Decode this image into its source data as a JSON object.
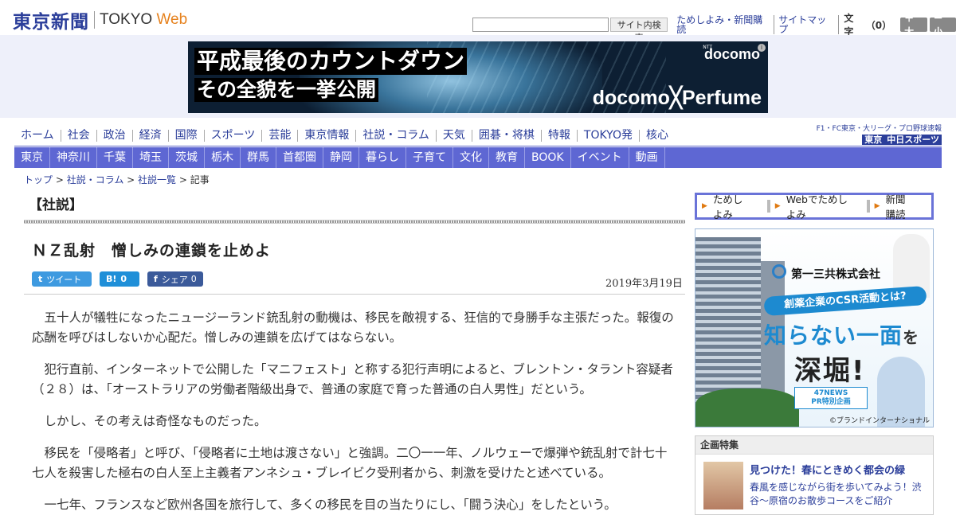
{
  "header": {
    "logo_jp": "東京新聞",
    "logo_en_prefix": "TOKYO ",
    "logo_en_suffix": "Web",
    "search_button": "サイト内検索",
    "links": [
      "ためしよみ・新聞購読",
      "サイトマップ"
    ],
    "text_size_label": "文字",
    "text_size_count": "（0）",
    "larger": "＋大",
    "smaller": "－小"
  },
  "banner": {
    "line1": "平成最後のカウントダウン",
    "line2": "その全貌を一挙公開",
    "brand": "docomo",
    "brand_small": "NTT",
    "collab": "docomo╳Perfume",
    "info": "i"
  },
  "nav_primary": [
    "ホーム",
    "社会",
    "政治",
    "経済",
    "国際",
    "スポーツ",
    "芸能",
    "東京情報",
    "社説・コラム",
    "天気",
    "囲碁・将棋",
    "特報",
    "TOKYO発",
    "核心"
  ],
  "sports_logo": {
    "top": "F1・FC東京・大リーグ・プロ野球速報",
    "prefix": "東京",
    "name": "中日スポーツ"
  },
  "nav_secondary": [
    "東京",
    "神奈川",
    "千葉",
    "埼玉",
    "茨城",
    "栃木",
    "群馬",
    "首都圏",
    "静岡",
    "暮らし",
    "子育て",
    "文化",
    "教育",
    "BOOK",
    "イベント",
    "動画"
  ],
  "breadcrumb": [
    "トップ",
    "社説・コラム",
    "社説一覧",
    "記事"
  ],
  "breadcrumb_sep": " > ",
  "article": {
    "section": "【社説】",
    "title": "ＮＺ乱射　憎しみの連鎖を止めよ",
    "date": "2019年3月19日",
    "share": {
      "tweet_icon": "t",
      "tweet": "ツイート",
      "hatena_icon": "B!",
      "hatena_count": "0",
      "fb_icon": "f",
      "fb": "シェア",
      "fb_count": "0"
    },
    "paragraphs": [
      "五十人が犠牲になったニュージーランド銃乱射の動機は、移民を敵視する、狂信的で身勝手な主張だった。報復の応酬を呼びはしないか心配だ。憎しみの連鎖を広げてはならない。",
      "犯行直前、インターネットで公開した「マニフェスト」と称する犯行声明によると、ブレントン・タラント容疑者（２８）は、「オーストラリアの労働者階級出身で、普通の家庭で育った普通の白人男性」だという。",
      "しかし、その考えは奇怪なものだった。",
      "移民を「侵略者」と呼び、「侵略者に土地は渡さない」と強調。二〇一一年、ノルウェーで爆弾や銃乱射で計七十七人を殺害した極右の白人至上主義者アンネシュ・ブレイビク受刑者から、刺激を受けたと述べている。",
      "一七年、フランスなど欧州各国を旅行して、多くの移民を目の当たりにし、「闘う決心」をしたという。"
    ]
  },
  "sidebar": {
    "links": [
      "ためしよみ",
      "Webでためしよみ",
      "新聞購読"
    ],
    "ad": {
      "company": "第一三共株式会社",
      "pill": "創薬企業のCSR活動とは?",
      "big1": "知らない一面",
      "big1_suffix": "を",
      "big2": "深堀!",
      "news1": "47NEWS",
      "news2": "PR特別企画",
      "credit": "©ブランドインターナショナル"
    },
    "feature": {
      "heading": "企画特集",
      "title": "見つけた！春にときめく都会の緑",
      "desc": "春風を感じながら街を歩いてみよう！渋谷～原宿のお散歩コースをご紹介"
    }
  }
}
